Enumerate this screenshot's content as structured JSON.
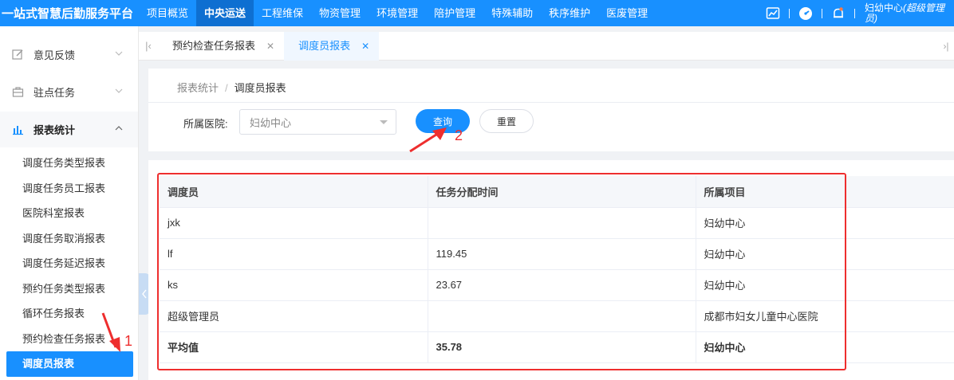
{
  "header": {
    "brand": "一站式智慧后勤服务平台",
    "nav": [
      {
        "label": "项目概览",
        "active": false
      },
      {
        "label": "中央运送",
        "active": true
      },
      {
        "label": "工程维保",
        "active": false
      },
      {
        "label": "物资管理",
        "active": false
      },
      {
        "label": "环境管理",
        "active": false
      },
      {
        "label": "陪护管理",
        "active": false
      },
      {
        "label": "特殊辅助",
        "active": false
      },
      {
        "label": "秩序维护",
        "active": false
      },
      {
        "label": "医废管理",
        "active": false
      }
    ],
    "icons": [
      "chart-icon",
      "dashboard-icon",
      "bell-icon"
    ],
    "user_name": "妇幼中心",
    "user_role": "(超级管理员)"
  },
  "sidebar": {
    "groups": [
      {
        "label": "意见反馈",
        "icon": "edit-icon"
      },
      {
        "label": "驻点任务",
        "icon": "briefcase-icon"
      },
      {
        "label": "报表统计",
        "icon": "bar-chart-icon"
      }
    ],
    "items": [
      {
        "label": "调度任务类型报表"
      },
      {
        "label": "调度任务员工报表"
      },
      {
        "label": "医院科室报表"
      },
      {
        "label": "调度任务取消报表"
      },
      {
        "label": "调度任务延迟报表"
      },
      {
        "label": "预约任务类型报表"
      },
      {
        "label": "循环任务报表"
      },
      {
        "label": "预约检查任务报表"
      },
      {
        "label": "调度员报表"
      }
    ],
    "active_item": "调度员报表"
  },
  "tabs": [
    {
      "label": "预约检查任务报表",
      "active": false
    },
    {
      "label": "调度员报表",
      "active": true
    }
  ],
  "breadcrumb": {
    "parent": "报表统计",
    "separator": "/",
    "current": "调度员报表"
  },
  "filter": {
    "hospital_label": "所属医院:",
    "hospital_value": "妇幼中心",
    "query_label": "查询",
    "reset_label": "重置"
  },
  "table": {
    "columns": [
      "调度员",
      "任务分配时间",
      "所属项目"
    ],
    "rows": [
      [
        "jxk",
        "",
        "妇幼中心"
      ],
      [
        "lf",
        "119.45",
        "妇幼中心"
      ],
      [
        "ks",
        "23.67",
        "妇幼中心"
      ],
      [
        "超级管理员",
        "",
        "成都市妇女儿童中心医院"
      ]
    ],
    "average": [
      "平均值",
      "35.78",
      "妇幼中心"
    ]
  },
  "annotations": {
    "step1": "1",
    "step2": "2",
    "color": "#ee2e2e"
  },
  "colors": {
    "primary": "#1890ff",
    "annotation": "#ee2e2e"
  }
}
